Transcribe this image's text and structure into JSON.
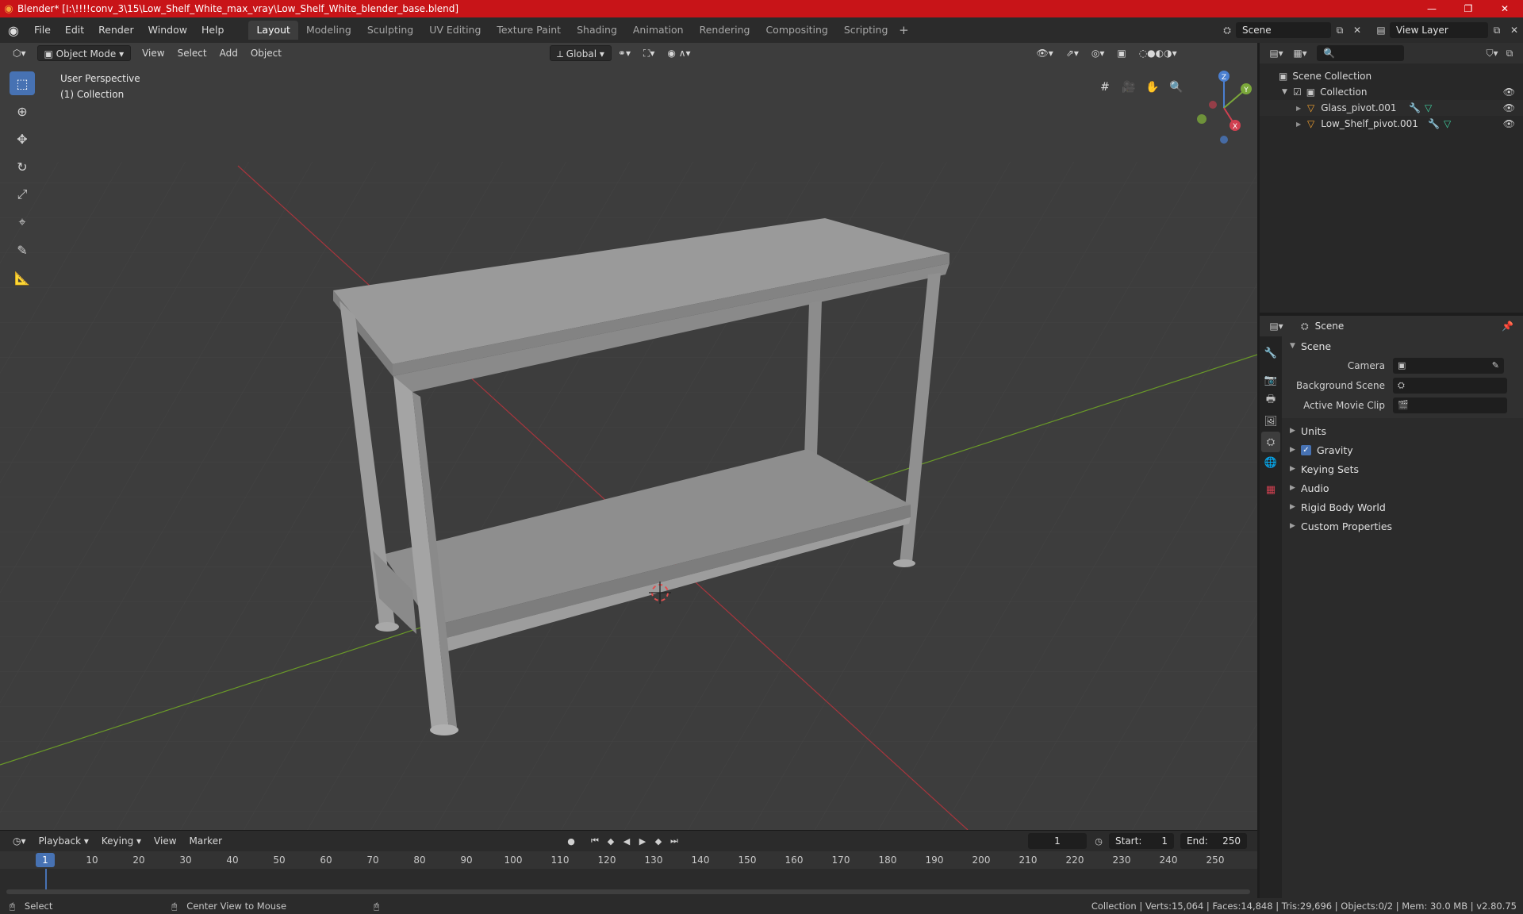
{
  "window": {
    "title": "Blender* [I:\\!!!!conv_3\\15\\Low_Shelf_White_max_vray\\Low_Shelf_White_blender_base.blend]",
    "controls": [
      "—",
      "❐",
      "✕"
    ]
  },
  "menubar": {
    "menus": [
      "File",
      "Edit",
      "Render",
      "Window",
      "Help"
    ],
    "workspaces": [
      "Layout",
      "Modeling",
      "Sculpting",
      "UV Editing",
      "Texture Paint",
      "Shading",
      "Animation",
      "Rendering",
      "Compositing",
      "Scripting"
    ],
    "active_workspace": "Layout",
    "add_workspace": "+",
    "scene_name": "Scene",
    "view_layer": "View Layer"
  },
  "viewport": {
    "mode": "Object Mode",
    "menus": [
      "View",
      "Select",
      "Add",
      "Object"
    ],
    "transform_orientation": "Global",
    "perspective_label": "User Perspective",
    "collection_label": "(1) Collection",
    "gizmo": {
      "z": "Z",
      "y": "Y",
      "x": "X"
    }
  },
  "outliner": {
    "root": "Scene Collection",
    "collection": "Collection",
    "objects": [
      {
        "name": "Glass_pivot.001"
      },
      {
        "name": "Low_Shelf_pivot.001"
      }
    ]
  },
  "properties": {
    "context": "Scene",
    "panel": "Scene",
    "fields": [
      {
        "label": "Camera"
      },
      {
        "label": "Background Scene"
      },
      {
        "label": "Active Movie Clip"
      }
    ],
    "subpanels": [
      "Units",
      "Gravity",
      "Keying Sets",
      "Audio",
      "Rigid Body World",
      "Custom Properties"
    ],
    "gravity_enabled": true
  },
  "timeline": {
    "menus": [
      "Playback",
      "Keying",
      "View",
      "Marker"
    ],
    "current_frame": "1",
    "start_label": "Start:",
    "start": "1",
    "end_label": "End:",
    "end": "250",
    "ruler": [
      "1",
      "10",
      "20",
      "30",
      "40",
      "50",
      "60",
      "70",
      "80",
      "90",
      "100",
      "110",
      "120",
      "130",
      "140",
      "150",
      "160",
      "170",
      "180",
      "190",
      "200",
      "210",
      "220",
      "230",
      "240",
      "250"
    ]
  },
  "statusbar": {
    "select": "Select",
    "center_view": "Center View to Mouse",
    "stats": "Collection | Verts:15,064 | Faces:14,848 | Tris:29,696 | Objects:0/2 | Mem: 30.0 MB | v2.80.75"
  }
}
